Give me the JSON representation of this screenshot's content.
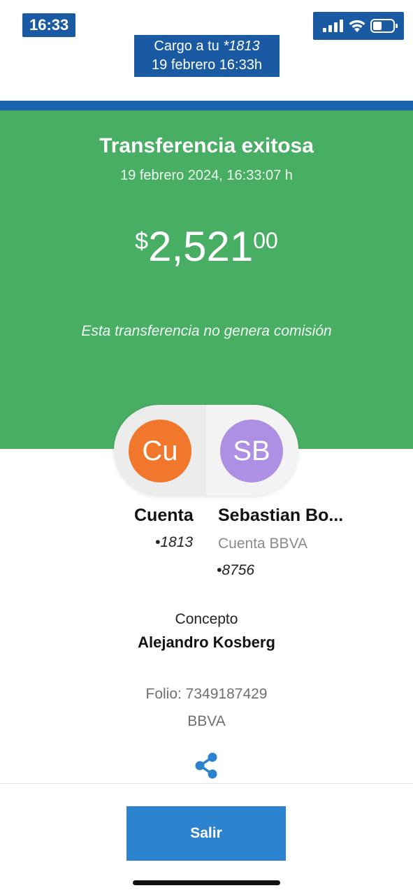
{
  "status_bar": {
    "time": "16:33"
  },
  "notification": {
    "line1_prefix": "Cargo a tu ",
    "line1_account": "*1813",
    "line2": "19 febrero 16:33h"
  },
  "transfer": {
    "title": "Transferencia exitosa",
    "datetime": "19 febrero 2024, 16:33:07 h",
    "amount": {
      "currency": "$",
      "integer": "2,521",
      "decimals": "00"
    },
    "commission_note": "Esta transferencia no genera comisión"
  },
  "from_account": {
    "initials": "Cu",
    "name": "Cuenta",
    "number": "•1813"
  },
  "to_account": {
    "initials": "SB",
    "name": "Sebastian Bo...",
    "bank_label": "Cuenta BBVA",
    "number": "•8756"
  },
  "concept": {
    "label": "Concepto",
    "value": "Alejandro Kosberg"
  },
  "folio": "Folio: 7349187429",
  "bank": "BBVA",
  "actions": {
    "exit_label": "Salir"
  },
  "colors": {
    "hero_green": "#48ae64",
    "brand_blue": "#1964ad",
    "button_blue": "#2b83d0",
    "avatar_orange": "#f0772c",
    "avatar_purple": "#ad8fe3"
  },
  "icons": {
    "signal": "signal-icon",
    "wifi": "wifi-icon",
    "battery": "battery-icon",
    "share": "share-icon"
  }
}
